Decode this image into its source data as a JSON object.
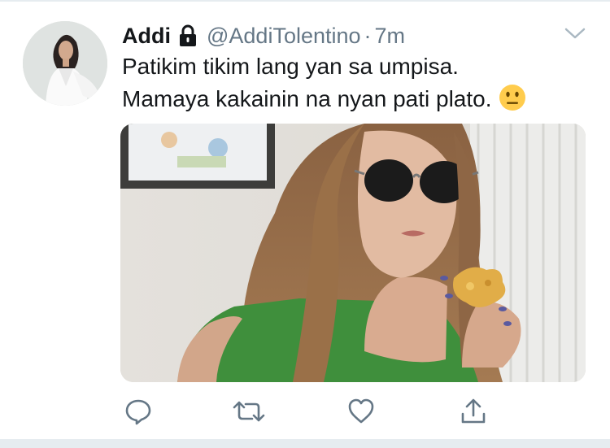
{
  "tweet": {
    "display_name": "Addi",
    "protected_icon": "lock-icon",
    "handle": "@AddiTolentino",
    "separator": "·",
    "timestamp": "7m",
    "text_lines": [
      "Patikim tikim lang yan sa umpisa.",
      "Mamaya kakainin na nyan pati plato."
    ],
    "emoji": "neutral-face-emoji",
    "menu_icon": "chevron-down-icon"
  },
  "actions": [
    {
      "name": "reply",
      "icon": "speech-bubble-icon"
    },
    {
      "name": "retweet",
      "icon": "retweet-arrows-icon"
    },
    {
      "name": "like",
      "icon": "heart-icon"
    },
    {
      "name": "share",
      "icon": "upload-share-icon"
    }
  ],
  "colors": {
    "text": "#14171a",
    "secondary_text": "#657786",
    "icon_gray": "#657786",
    "divider": "#e6ecf0"
  }
}
